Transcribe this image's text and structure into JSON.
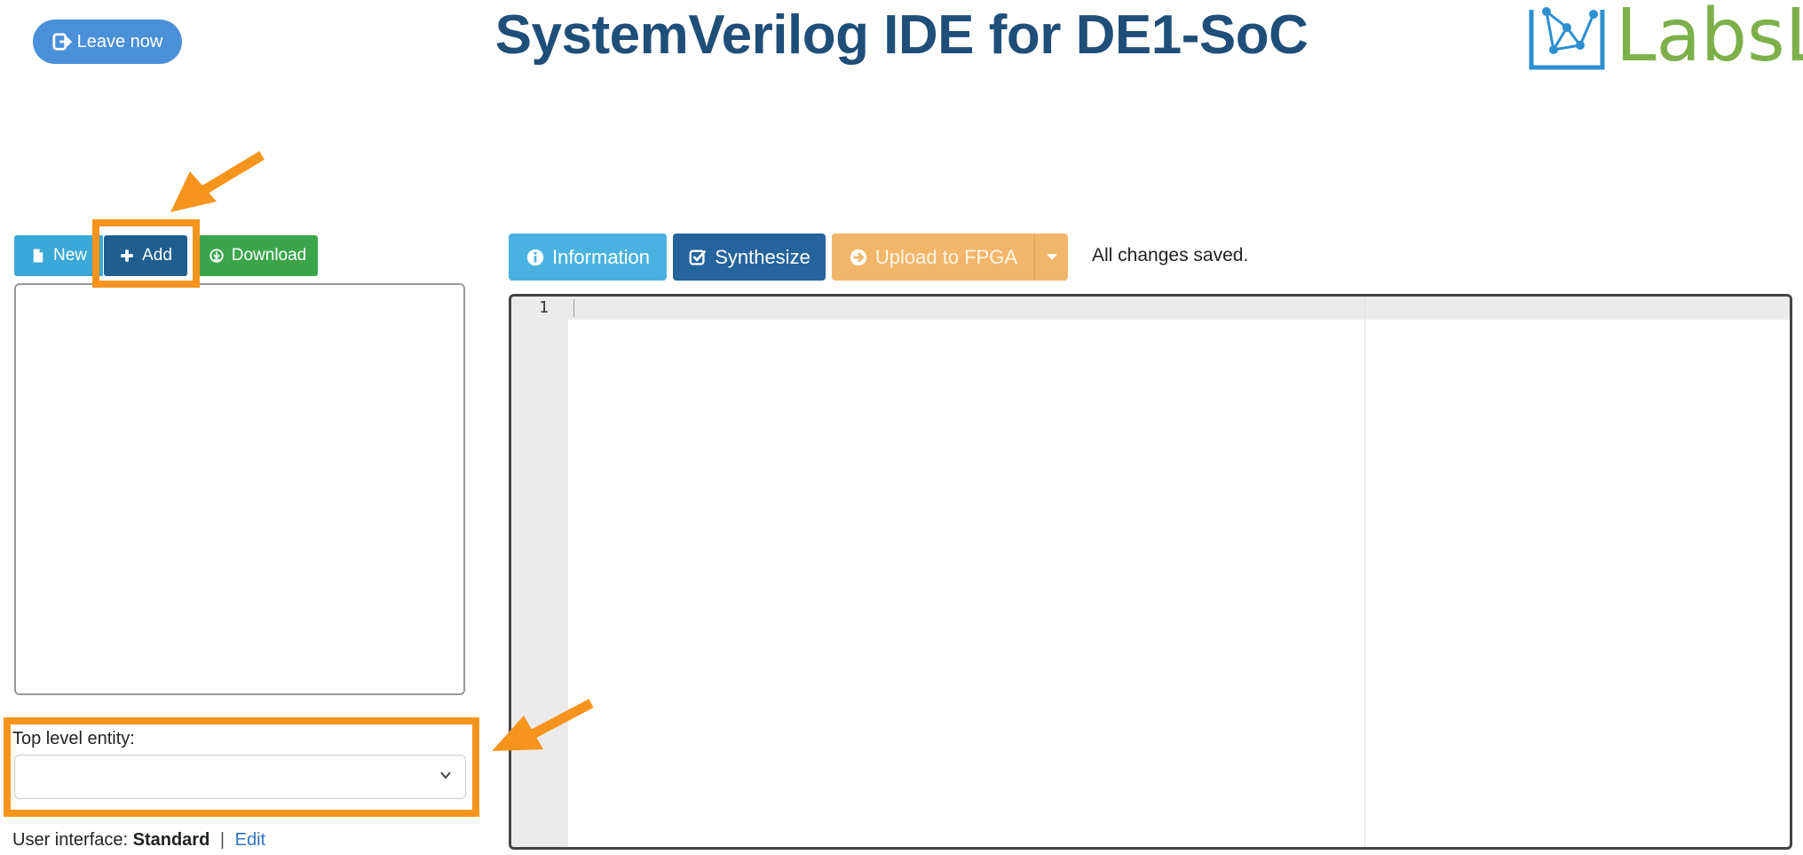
{
  "header": {
    "leave_label": "Leave now",
    "title": "SystemVerilog IDE for DE1-SoC",
    "logo_text": "LabsL"
  },
  "file_panel": {
    "toolbar": {
      "new_label": "New",
      "add_label": "Add",
      "download_label": "Download"
    },
    "files": []
  },
  "top_level_entity": {
    "label": "Top level entity:",
    "selected": ""
  },
  "user_interface": {
    "prefix": "User interface:",
    "mode": "Standard",
    "separator": "|",
    "edit_label": "Edit"
  },
  "editor_toolbar": {
    "information_label": "Information",
    "synthesize_label": "Synthesize",
    "upload_label": "Upload to FPGA",
    "status": "All changes saved."
  },
  "editor": {
    "lines": [
      "1"
    ],
    "content": ""
  },
  "icons": {
    "leave": "sign-out-icon",
    "new": "file-icon",
    "add": "plus-icon",
    "download": "download-circle-icon",
    "information": "info-circle-icon",
    "synthesize": "check-square-icon",
    "upload": "arrow-circle-right-icon",
    "dropdown": "caret-down-icon"
  },
  "colors": {
    "title": "#1f4e79",
    "annotation": "#f7941d",
    "new_button": "#3aa8d8",
    "add_button": "#1f5e8f",
    "download_button": "#3aa54a",
    "information_button": "#4ab2e0",
    "synthesize_button": "#25639c",
    "upload_button": "#f2b66a",
    "logo_text": "#7db04a"
  }
}
